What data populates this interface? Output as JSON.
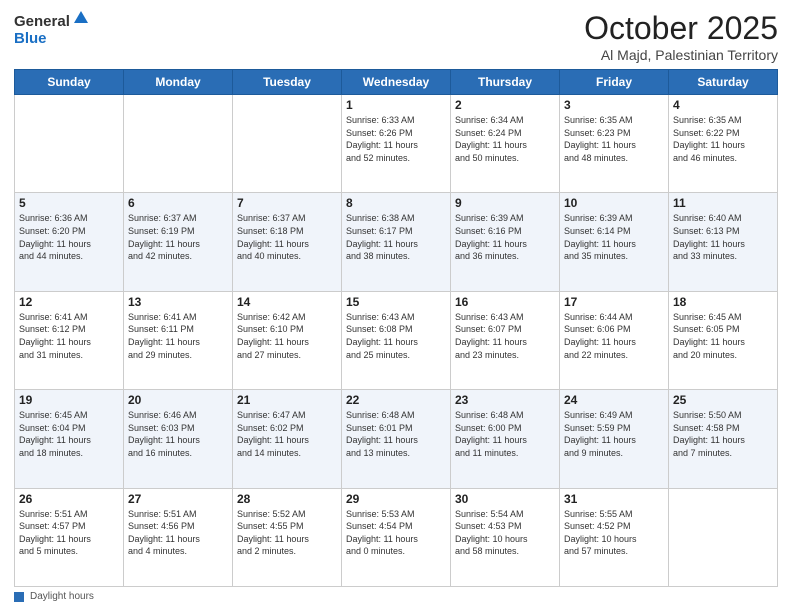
{
  "logo": {
    "general": "General",
    "blue": "Blue"
  },
  "title": "October 2025",
  "subtitle": "Al Majd, Palestinian Territory",
  "days_of_week": [
    "Sunday",
    "Monday",
    "Tuesday",
    "Wednesday",
    "Thursday",
    "Friday",
    "Saturday"
  ],
  "footer_label": "Daylight hours",
  "weeks": [
    [
      {
        "day": "",
        "info": ""
      },
      {
        "day": "",
        "info": ""
      },
      {
        "day": "",
        "info": ""
      },
      {
        "day": "1",
        "info": "Sunrise: 6:33 AM\nSunset: 6:26 PM\nDaylight: 11 hours\nand 52 minutes."
      },
      {
        "day": "2",
        "info": "Sunrise: 6:34 AM\nSunset: 6:24 PM\nDaylight: 11 hours\nand 50 minutes."
      },
      {
        "day": "3",
        "info": "Sunrise: 6:35 AM\nSunset: 6:23 PM\nDaylight: 11 hours\nand 48 minutes."
      },
      {
        "day": "4",
        "info": "Sunrise: 6:35 AM\nSunset: 6:22 PM\nDaylight: 11 hours\nand 46 minutes."
      }
    ],
    [
      {
        "day": "5",
        "info": "Sunrise: 6:36 AM\nSunset: 6:20 PM\nDaylight: 11 hours\nand 44 minutes."
      },
      {
        "day": "6",
        "info": "Sunrise: 6:37 AM\nSunset: 6:19 PM\nDaylight: 11 hours\nand 42 minutes."
      },
      {
        "day": "7",
        "info": "Sunrise: 6:37 AM\nSunset: 6:18 PM\nDaylight: 11 hours\nand 40 minutes."
      },
      {
        "day": "8",
        "info": "Sunrise: 6:38 AM\nSunset: 6:17 PM\nDaylight: 11 hours\nand 38 minutes."
      },
      {
        "day": "9",
        "info": "Sunrise: 6:39 AM\nSunset: 6:16 PM\nDaylight: 11 hours\nand 36 minutes."
      },
      {
        "day": "10",
        "info": "Sunrise: 6:39 AM\nSunset: 6:14 PM\nDaylight: 11 hours\nand 35 minutes."
      },
      {
        "day": "11",
        "info": "Sunrise: 6:40 AM\nSunset: 6:13 PM\nDaylight: 11 hours\nand 33 minutes."
      }
    ],
    [
      {
        "day": "12",
        "info": "Sunrise: 6:41 AM\nSunset: 6:12 PM\nDaylight: 11 hours\nand 31 minutes."
      },
      {
        "day": "13",
        "info": "Sunrise: 6:41 AM\nSunset: 6:11 PM\nDaylight: 11 hours\nand 29 minutes."
      },
      {
        "day": "14",
        "info": "Sunrise: 6:42 AM\nSunset: 6:10 PM\nDaylight: 11 hours\nand 27 minutes."
      },
      {
        "day": "15",
        "info": "Sunrise: 6:43 AM\nSunset: 6:08 PM\nDaylight: 11 hours\nand 25 minutes."
      },
      {
        "day": "16",
        "info": "Sunrise: 6:43 AM\nSunset: 6:07 PM\nDaylight: 11 hours\nand 23 minutes."
      },
      {
        "day": "17",
        "info": "Sunrise: 6:44 AM\nSunset: 6:06 PM\nDaylight: 11 hours\nand 22 minutes."
      },
      {
        "day": "18",
        "info": "Sunrise: 6:45 AM\nSunset: 6:05 PM\nDaylight: 11 hours\nand 20 minutes."
      }
    ],
    [
      {
        "day": "19",
        "info": "Sunrise: 6:45 AM\nSunset: 6:04 PM\nDaylight: 11 hours\nand 18 minutes."
      },
      {
        "day": "20",
        "info": "Sunrise: 6:46 AM\nSunset: 6:03 PM\nDaylight: 11 hours\nand 16 minutes."
      },
      {
        "day": "21",
        "info": "Sunrise: 6:47 AM\nSunset: 6:02 PM\nDaylight: 11 hours\nand 14 minutes."
      },
      {
        "day": "22",
        "info": "Sunrise: 6:48 AM\nSunset: 6:01 PM\nDaylight: 11 hours\nand 13 minutes."
      },
      {
        "day": "23",
        "info": "Sunrise: 6:48 AM\nSunset: 6:00 PM\nDaylight: 11 hours\nand 11 minutes."
      },
      {
        "day": "24",
        "info": "Sunrise: 6:49 AM\nSunset: 5:59 PM\nDaylight: 11 hours\nand 9 minutes."
      },
      {
        "day": "25",
        "info": "Sunrise: 5:50 AM\nSunset: 4:58 PM\nDaylight: 11 hours\nand 7 minutes."
      }
    ],
    [
      {
        "day": "26",
        "info": "Sunrise: 5:51 AM\nSunset: 4:57 PM\nDaylight: 11 hours\nand 5 minutes."
      },
      {
        "day": "27",
        "info": "Sunrise: 5:51 AM\nSunset: 4:56 PM\nDaylight: 11 hours\nand 4 minutes."
      },
      {
        "day": "28",
        "info": "Sunrise: 5:52 AM\nSunset: 4:55 PM\nDaylight: 11 hours\nand 2 minutes."
      },
      {
        "day": "29",
        "info": "Sunrise: 5:53 AM\nSunset: 4:54 PM\nDaylight: 11 hours\nand 0 minutes."
      },
      {
        "day": "30",
        "info": "Sunrise: 5:54 AM\nSunset: 4:53 PM\nDaylight: 10 hours\nand 58 minutes."
      },
      {
        "day": "31",
        "info": "Sunrise: 5:55 AM\nSunset: 4:52 PM\nDaylight: 10 hours\nand 57 minutes."
      },
      {
        "day": "",
        "info": ""
      }
    ]
  ]
}
